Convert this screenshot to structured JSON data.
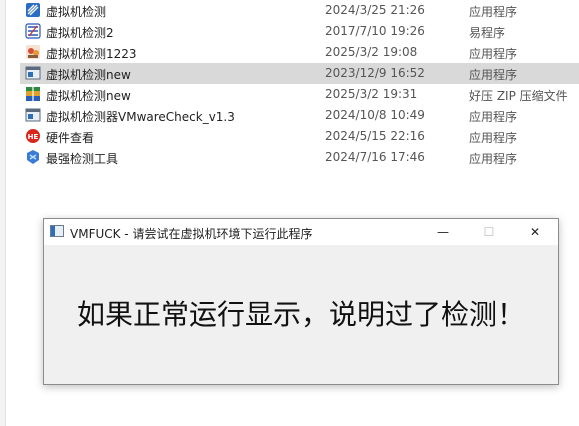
{
  "files": [
    {
      "name": "虚拟机检测",
      "date": "2024/3/25 21:26",
      "type": "应用程序",
      "icon": "app-blue-icon",
      "selected": false
    },
    {
      "name": "虚拟机检测2",
      "date": "2017/7/10 19:26",
      "type": "易程序",
      "icon": "easy-language-icon",
      "selected": false
    },
    {
      "name": "虚拟机检测1223",
      "date": "2025/3/2 19:08",
      "type": "应用程序",
      "icon": "image-app-icon",
      "selected": false
    },
    {
      "name": "虚拟机检测new",
      "date": "2023/12/9 16:52",
      "type": "应用程序",
      "icon": "window-app-icon",
      "selected": true
    },
    {
      "name": "虚拟机检测new",
      "date": "2025/3/2 19:31",
      "type": "好压 ZIP 压缩文件",
      "icon": "zip-archive-icon",
      "selected": false
    },
    {
      "name": "虚拟机检测器VMwareCheck_v1.3",
      "date": "2024/10/8 10:49",
      "type": "应用程序",
      "icon": "window-app-icon",
      "selected": false
    },
    {
      "name": "硬件查看",
      "date": "2024/5/15 22:16",
      "type": "应用程序",
      "icon": "hardware-info-icon",
      "selected": false
    },
    {
      "name": "最强检测工具",
      "date": "2024/7/16 17:46",
      "type": "应用程序",
      "icon": "blue-tool-icon",
      "selected": false
    }
  ],
  "dialog": {
    "title": "VMFUCK - 请尝试在虚拟机环境下运行此程序",
    "message": "如果正常运行显示，说明过了检测！",
    "minimize_symbol": "—",
    "maximize_symbol": "☐",
    "close_symbol": "✕"
  }
}
